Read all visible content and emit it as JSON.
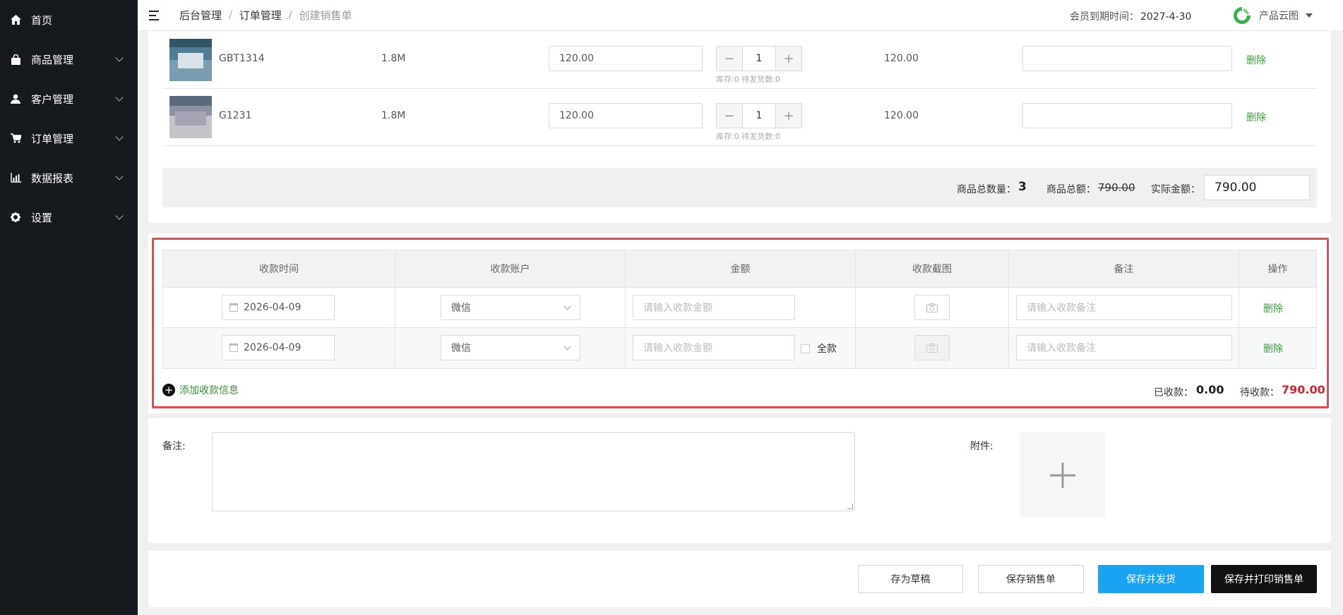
{
  "sidebar": {
    "items": [
      {
        "label": "首页",
        "icon": "home-icon"
      },
      {
        "label": "商品管理",
        "icon": "bag-icon"
      },
      {
        "label": "客户管理",
        "icon": "user-icon"
      },
      {
        "label": "订单管理",
        "icon": "cart-icon"
      },
      {
        "label": "数据报表",
        "icon": "chart-icon"
      },
      {
        "label": "设置",
        "icon": "gear-icon"
      }
    ]
  },
  "header": {
    "breadcrumb": [
      "后台管理",
      "订单管理",
      "创建销售单"
    ],
    "separator": "/",
    "member_label": "会员到期时间：",
    "member_date": "2027-4-30",
    "brand": "产品云图",
    "brand_color": "#3cb04a"
  },
  "products": [
    {
      "code": "GBT1314",
      "spec": "1.8M",
      "price": "120.00",
      "qty": "1",
      "stock": "库存:0 待发货数:0",
      "total": "120.00",
      "action": "删除"
    },
    {
      "code": "G1231",
      "spec": "1.8M",
      "price": "120.00",
      "qty": "1",
      "stock": "库存:0 待发货数:0",
      "total": "120.00",
      "action": "删除"
    }
  ],
  "stepper": {
    "minus": "−",
    "plus": "+"
  },
  "summary": {
    "qty_label": "商品总数量：",
    "qty": "3",
    "amount_label": "商品总额：",
    "amount": "790.00",
    "actual_label": "实际金额：",
    "actual": "790.00"
  },
  "payment": {
    "headers": [
      "收款时间",
      "收款账户",
      "金额",
      "收款截图",
      "备注",
      "操作"
    ],
    "rows": [
      {
        "date": "2026-04-09",
        "account": "微信",
        "amount_placeholder": "请输入收款金额",
        "note_placeholder": "请输入收款备注",
        "action": "删除"
      },
      {
        "date": "2026-04-09",
        "account": "微信",
        "amount_placeholder": "请输入收款金额",
        "full_label": "全款",
        "note_placeholder": "请输入收款备注",
        "action": "删除"
      }
    ],
    "add_label": "添加收款信息",
    "paid_label": "已收款：",
    "paid": "0.00",
    "due_label": "待收款：",
    "due": "790.00"
  },
  "remarks": {
    "note_label": "备注:",
    "attachment_label": "附件:"
  },
  "actions": {
    "draft": "存为草稿",
    "save": "保存销售单",
    "save_ship": "保存并发货",
    "save_print": "保存并打印销售单"
  },
  "colors": {
    "sidebar": "#16191d",
    "link_green": "#3aa03a",
    "primary_blue": "#1aa3f0",
    "danger_red": "#e5484d"
  }
}
